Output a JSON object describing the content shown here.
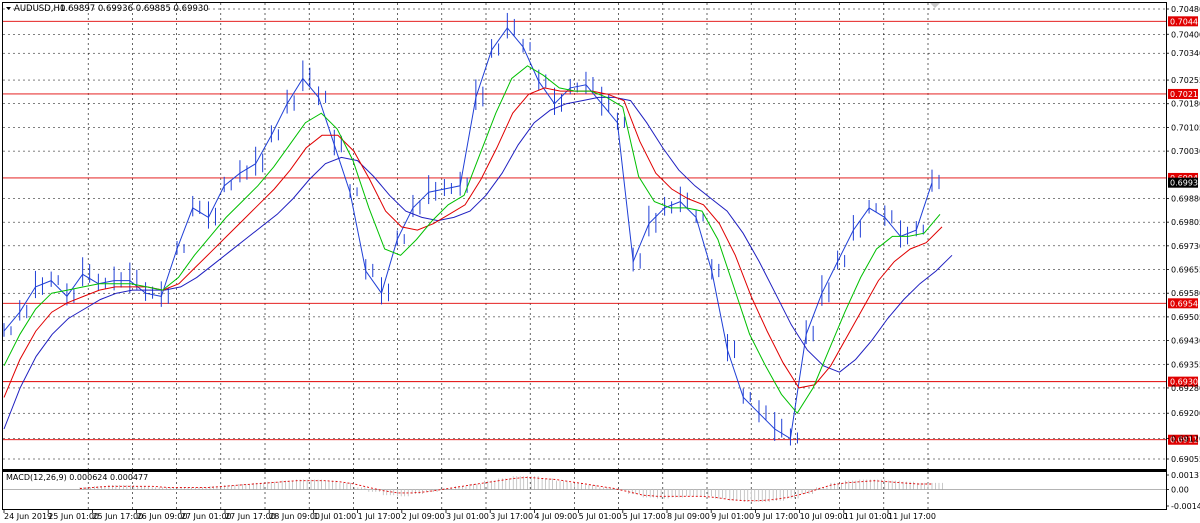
{
  "header": {
    "symbol_timeframe": "AUDUSD,H1",
    "ohlc": "0.69897 0.69936 0.69885 0.69930"
  },
  "colors": {
    "price": "#1f3fd6",
    "ma_fast": "#00c000",
    "ma_mid": "#e00000",
    "ma_slow": "#1f1fc0",
    "levels": "#e00000",
    "macd": "#e00000"
  },
  "chart_data": [
    {
      "type": "line",
      "name": "price",
      "y_axis_ticks": [
        "0.70480",
        "0.70400",
        "0.70340",
        "0.70255",
        "0.70180",
        "0.70105",
        "0.70030",
        "0.69880",
        "0.69805",
        "0.69730",
        "0.69655",
        "0.69580",
        "0.69505",
        "0.69430",
        "0.69355",
        "0.69280",
        "0.69200",
        "0.69120",
        "0.69055"
      ],
      "ylim": [
        0.69055,
        0.7048
      ],
      "current_price": "0.69930",
      "levels": [
        "0.70441",
        "0.70211",
        "0.69945",
        "0.69548",
        "0.69300",
        "0.69116"
      ],
      "x_ticks": [
        "24 Jun 2019",
        "25 Jun 01:00",
        "25 Jun 17:00",
        "26 Jun 09:00",
        "27 Jun 01:00",
        "27 Jun 17:00",
        "28 Jun 09:00",
        "1 Jul 01:00",
        "1 Jul 17:00",
        "2 Jul 09:00",
        "3 Jul 01:00",
        "3 Jul 17:00",
        "4 Jul 09:00",
        "5 Jul 01:00",
        "5 Jul 17:00",
        "8 Jul 09:00",
        "9 Jul 01:00",
        "9 Jul 17:00",
        "10 Jul 09:00",
        "11 Jul 01:00",
        "11 Jul 17:00"
      ],
      "grid": true,
      "price_path": [
        0.6946,
        0.6952,
        0.696,
        0.6962,
        0.6957,
        0.6964,
        0.6961,
        0.6962,
        0.6962,
        0.6958,
        0.6957,
        0.6972,
        0.6985,
        0.6982,
        0.6992,
        0.6996,
        0.6999,
        0.7008,
        0.7018,
        0.7026,
        0.702,
        0.7005,
        0.699,
        0.6965,
        0.6958,
        0.6975,
        0.6985,
        0.699,
        0.6991,
        0.6992,
        0.702,
        0.7035,
        0.7042,
        0.7036,
        0.7025,
        0.7018,
        0.7023,
        0.7024,
        0.7018,
        0.7012,
        0.6968,
        0.698,
        0.6985,
        0.6987,
        0.6982,
        0.6965,
        0.694,
        0.6925,
        0.692,
        0.6915,
        0.6912,
        0.6945,
        0.6958,
        0.6968,
        0.6978,
        0.6985,
        0.6982,
        0.6976,
        0.6978,
        0.6993
      ],
      "ma_fast": [
        0.6935,
        0.6945,
        0.6953,
        0.6958,
        0.6959,
        0.696,
        0.6961,
        0.6961,
        0.6961,
        0.696,
        0.6959,
        0.6963,
        0.697,
        0.6976,
        0.6982,
        0.6987,
        0.6992,
        0.6998,
        0.7005,
        0.7012,
        0.7015,
        0.701,
        0.7,
        0.6985,
        0.6972,
        0.697,
        0.6975,
        0.6981,
        0.6986,
        0.6989,
        0.7002,
        0.7015,
        0.7026,
        0.703,
        0.7027,
        0.7023,
        0.7022,
        0.7022,
        0.702,
        0.7017,
        0.6995,
        0.6987,
        0.6985,
        0.6985,
        0.6984,
        0.6975,
        0.696,
        0.6945,
        0.6935,
        0.6926,
        0.692,
        0.6928,
        0.694,
        0.6952,
        0.6963,
        0.6972,
        0.6976,
        0.6976,
        0.6977,
        0.6983
      ],
      "ma_mid": [
        0.6925,
        0.6937,
        0.6946,
        0.6952,
        0.6955,
        0.6957,
        0.6959,
        0.696,
        0.696,
        0.696,
        0.6959,
        0.6961,
        0.6966,
        0.6971,
        0.6976,
        0.6981,
        0.6986,
        0.6991,
        0.6997,
        0.7004,
        0.7008,
        0.7008,
        0.7003,
        0.6994,
        0.6984,
        0.6979,
        0.6978,
        0.698,
        0.6983,
        0.6986,
        0.6994,
        0.7004,
        0.7015,
        0.7021,
        0.7023,
        0.7022,
        0.7022,
        0.7022,
        0.7021,
        0.7019,
        0.7006,
        0.6996,
        0.6991,
        0.6988,
        0.6986,
        0.698,
        0.697,
        0.6957,
        0.6946,
        0.6936,
        0.6928,
        0.6929,
        0.6935,
        0.6944,
        0.6953,
        0.6962,
        0.6968,
        0.6972,
        0.6974,
        0.6979
      ],
      "ma_slow": [
        0.6915,
        0.6928,
        0.6938,
        0.6945,
        0.695,
        0.6953,
        0.6956,
        0.6958,
        0.6959,
        0.6959,
        0.6959,
        0.696,
        0.6963,
        0.6967,
        0.6971,
        0.6975,
        0.6979,
        0.6983,
        0.6988,
        0.6994,
        0.6999,
        0.7001,
        0.7,
        0.6995,
        0.6989,
        0.6984,
        0.6982,
        0.6981,
        0.6982,
        0.6984,
        0.6989,
        0.6996,
        0.7005,
        0.7012,
        0.7016,
        0.7018,
        0.7019,
        0.702,
        0.702,
        0.7019,
        0.7012,
        0.7004,
        0.6997,
        0.6992,
        0.6988,
        0.6984,
        0.6977,
        0.6968,
        0.6958,
        0.6948,
        0.694,
        0.6935,
        0.6933,
        0.6937,
        0.6943,
        0.695,
        0.6956,
        0.6961,
        0.6965,
        0.697
      ]
    },
    {
      "type": "bar",
      "name": "macd",
      "label": "MACD(12,26,9) 0.000624 0.000477",
      "y_axis_ticks": [
        "0.00131",
        "0.00",
        "-0.001471"
      ],
      "ylim": [
        -0.001471,
        0.00131
      ],
      "histogram": [
        0.0002,
        0.0003,
        0.0004,
        0.0004,
        0.0003,
        0.0002,
        0.0002,
        0.0002,
        0.0002,
        0.0003,
        0.0004,
        0.0005,
        0.0006,
        0.0007,
        0.0008,
        0.0009,
        0.0009,
        0.0008,
        0.0006,
        0.0002,
        -0.0002,
        -0.0005,
        -0.0006,
        -0.0004,
        -0.0002,
        0.0001,
        0.0003,
        0.0005,
        0.0008,
        0.001,
        0.0012,
        0.0012,
        0.001,
        0.0008,
        0.0006,
        0.0004,
        0.0002,
        0.0,
        -0.0004,
        -0.0007,
        -0.0008,
        -0.0007,
        -0.0006,
        -0.0006,
        -0.0008,
        -0.001,
        -0.0011,
        -0.0011,
        -0.001,
        -0.0008,
        -0.0004,
        0.0002,
        0.0006,
        0.0008,
        0.0009,
        0.0009,
        0.0008,
        0.0007,
        0.0006,
        0.0006
      ],
      "signal": [
        0.0001,
        0.0002,
        0.0003,
        0.0003,
        0.0003,
        0.0003,
        0.0002,
        0.0002,
        0.0002,
        0.0002,
        0.0003,
        0.0004,
        0.0005,
        0.0006,
        0.0007,
        0.0008,
        0.0008,
        0.0008,
        0.0007,
        0.0005,
        0.0002,
        -0.0001,
        -0.0003,
        -0.0003,
        -0.0002,
        0.0,
        0.0002,
        0.0004,
        0.0006,
        0.0008,
        0.001,
        0.0011,
        0.001,
        0.0009,
        0.0007,
        0.0005,
        0.0003,
        0.0001,
        -0.0002,
        -0.0005,
        -0.0006,
        -0.0006,
        -0.0006,
        -0.0006,
        -0.0007,
        -0.0009,
        -0.001,
        -0.001,
        -0.0009,
        -0.0007,
        -0.0004,
        0.0,
        0.0004,
        0.0006,
        0.0007,
        0.0008,
        0.0007,
        0.0006,
        0.0005,
        0.0005
      ]
    }
  ]
}
